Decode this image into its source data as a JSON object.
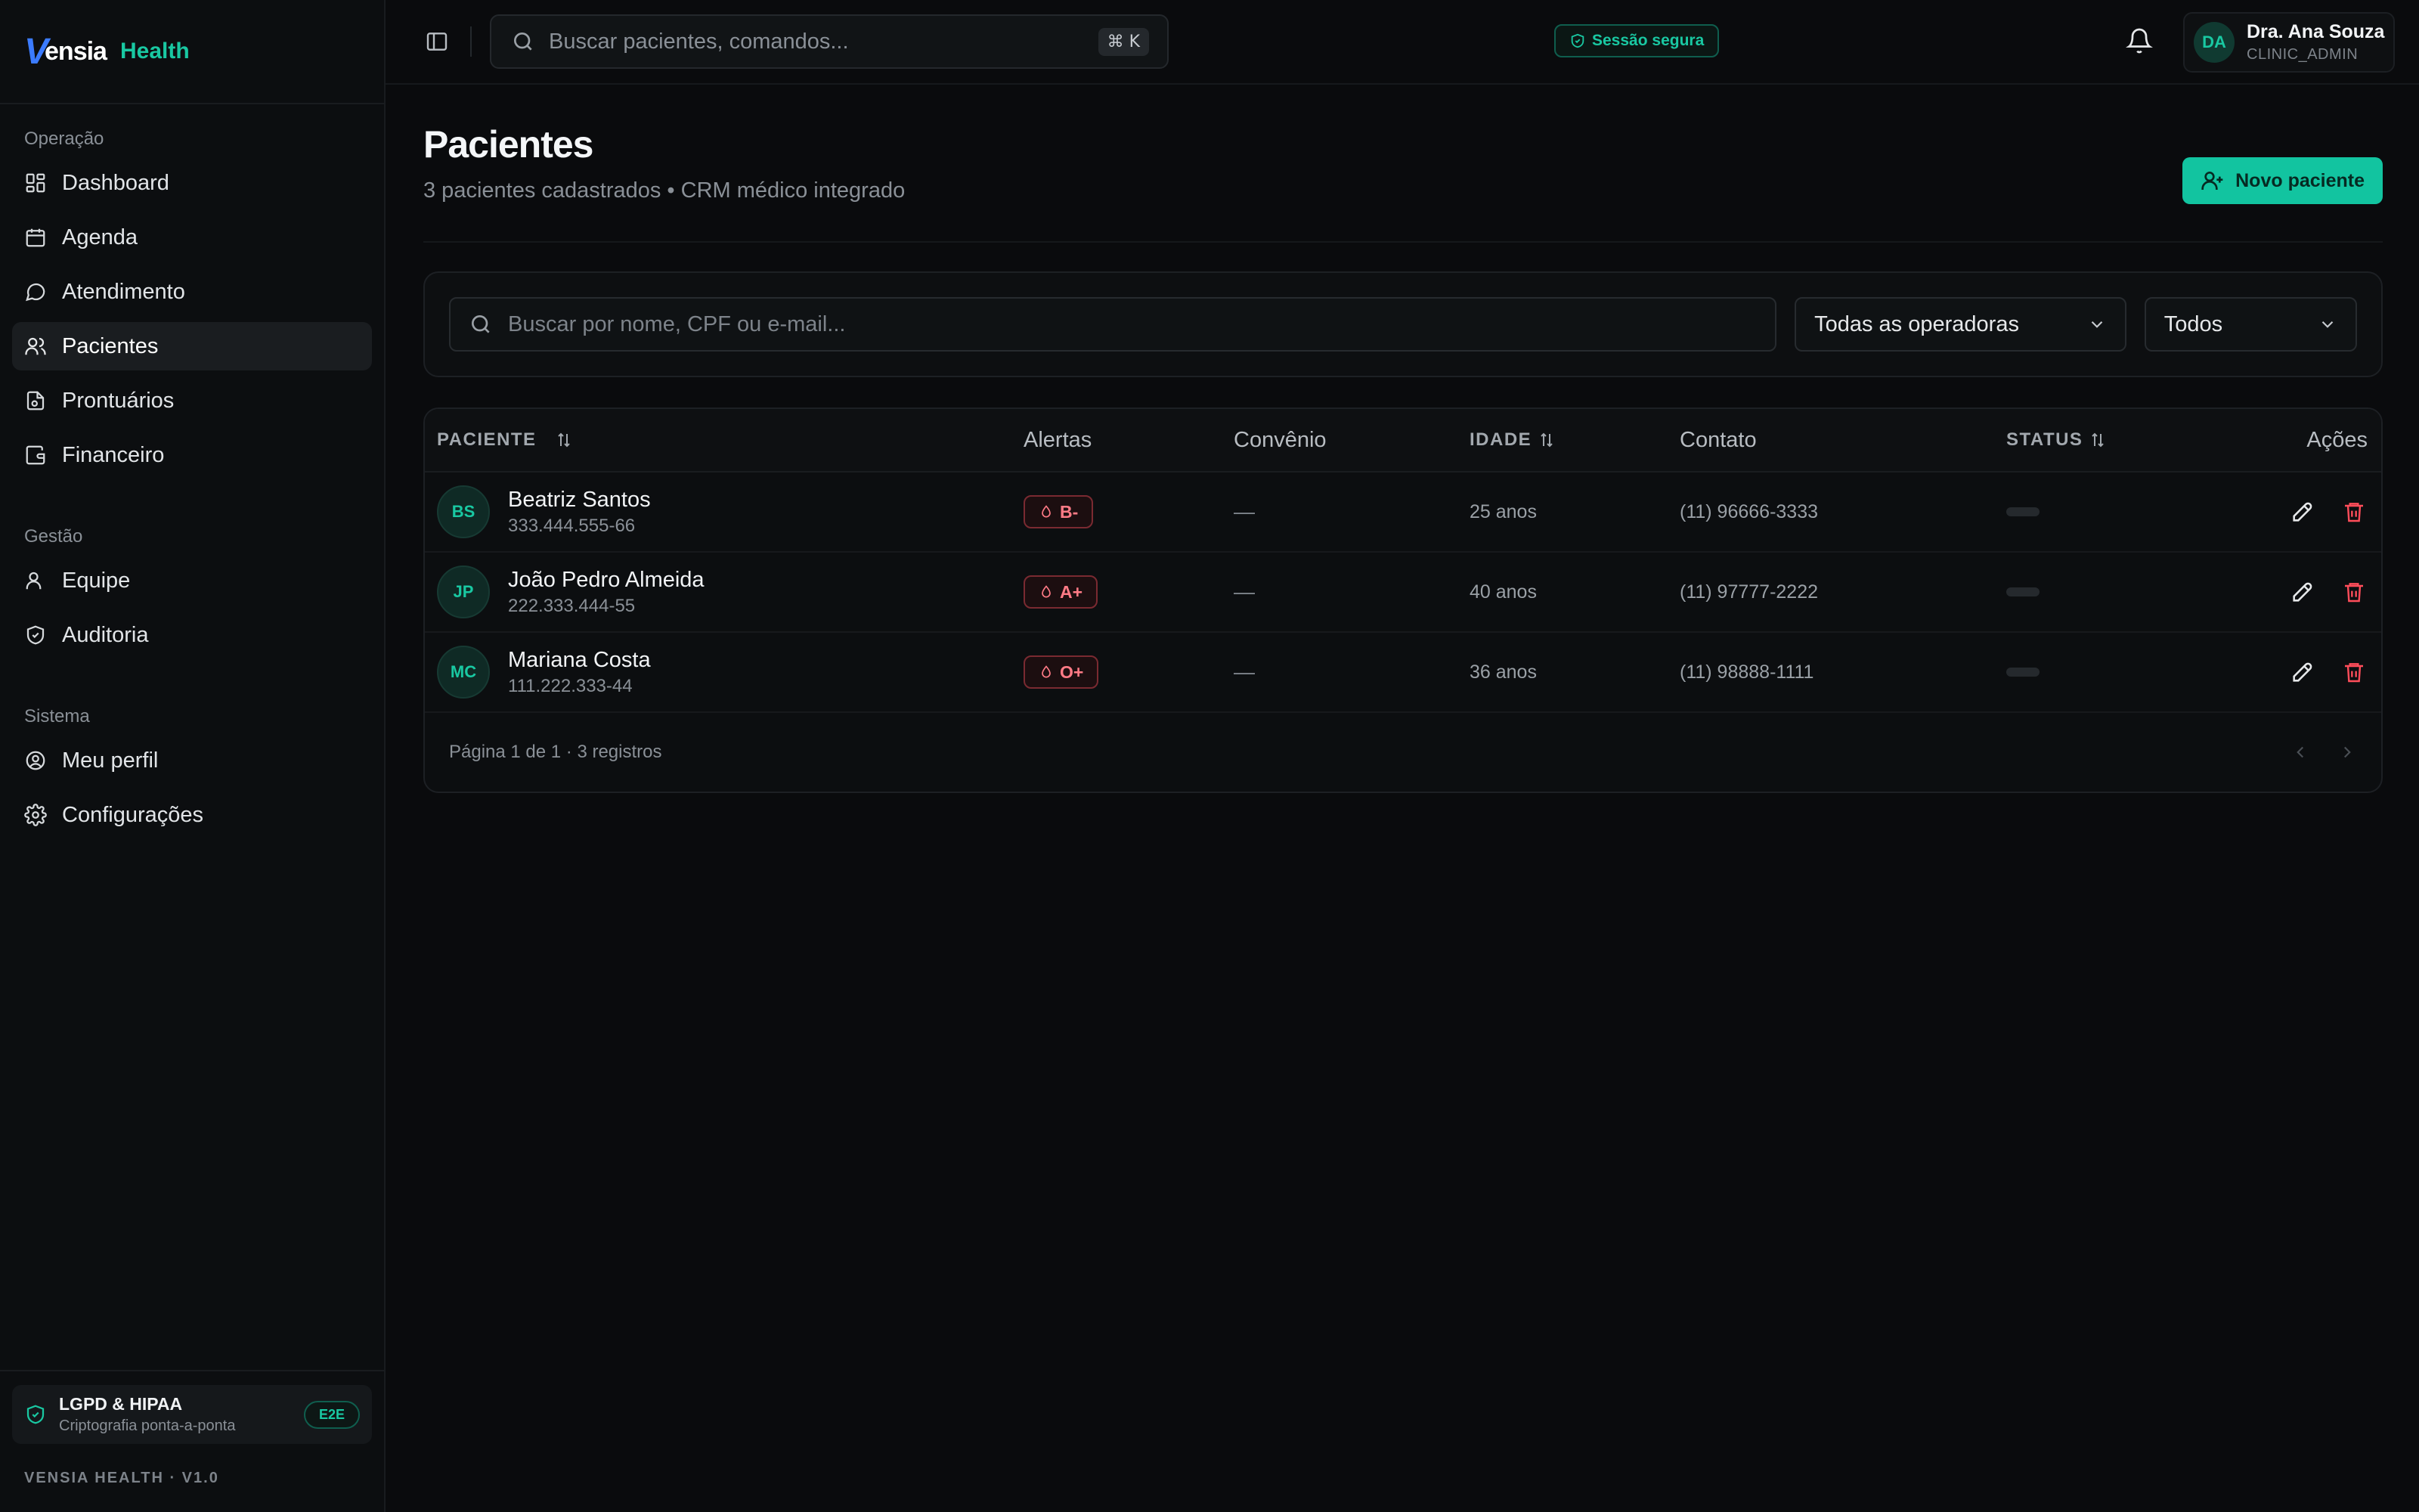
{
  "brand": {
    "logo_v": "V",
    "logo_rest": "ensia",
    "product": "Health"
  },
  "sidebar": {
    "sections": [
      {
        "heading": "Operação",
        "items": [
          {
            "label": "Dashboard",
            "icon": "dashboard-icon"
          },
          {
            "label": "Agenda",
            "icon": "calendar-icon"
          },
          {
            "label": "Atendimento",
            "icon": "chat-icon"
          },
          {
            "label": "Pacientes",
            "icon": "users-icon",
            "active": true
          },
          {
            "label": "Prontuários",
            "icon": "file-icon"
          },
          {
            "label": "Financeiro",
            "icon": "wallet-icon"
          }
        ]
      },
      {
        "heading": "Gestão",
        "items": [
          {
            "label": "Equipe",
            "icon": "user-icon"
          },
          {
            "label": "Auditoria",
            "icon": "shield-icon"
          }
        ]
      },
      {
        "heading": "Sistema",
        "items": [
          {
            "label": "Meu perfil",
            "icon": "user-circle-icon"
          },
          {
            "label": "Configurações",
            "icon": "gear-icon"
          }
        ]
      }
    ],
    "footer": {
      "compliance_title": "LGPD & HIPAA",
      "compliance_sub": "Criptografia ponta-a-ponta",
      "badge": "E2E",
      "version": "VENSIA HEALTH · V1.0"
    }
  },
  "topbar": {
    "search_placeholder": "Buscar pacientes, comandos...",
    "shortcut": "⌘ K",
    "secure_label": "Sessão segura",
    "user": {
      "initials": "DA",
      "name": "Dra. Ana Souza",
      "role": "CLINIC_ADMIN"
    }
  },
  "page": {
    "title": "Pacientes",
    "subtitle": "3 pacientes cadastrados • CRM médico integrado",
    "new_button": "Novo paciente"
  },
  "filters": {
    "search_placeholder": "Buscar por nome, CPF ou e-mail...",
    "operator_select": "Todas as operadoras",
    "status_select": "Todos"
  },
  "table": {
    "headers": {
      "patient": "PACIENTE",
      "alerts": "Alertas",
      "insurance": "Convênio",
      "age": "IDADE",
      "contact": "Contato",
      "status": "STATUS",
      "actions": "Ações"
    },
    "rows": [
      {
        "initials": "BS",
        "name": "Beatriz Santos",
        "cpf": "333.444.555-66",
        "blood": "B-",
        "insurance": "—",
        "age": "25 anos",
        "phone": "(11) 96666-3333"
      },
      {
        "initials": "JP",
        "name": "João Pedro Almeida",
        "cpf": "222.333.444-55",
        "blood": "A+",
        "insurance": "—",
        "age": "40 anos",
        "phone": "(11) 97777-2222"
      },
      {
        "initials": "MC",
        "name": "Mariana Costa",
        "cpf": "111.222.333-44",
        "blood": "O+",
        "insurance": "—",
        "age": "36 anos",
        "phone": "(11) 98888-1111"
      }
    ],
    "footer": "Página 1 de 1 · 3 registros"
  },
  "colors": {
    "accent": "#12c4a0",
    "brand_blue": "#3b7bff",
    "danger": "#ff4d5a",
    "background": "#0a0b0d"
  }
}
